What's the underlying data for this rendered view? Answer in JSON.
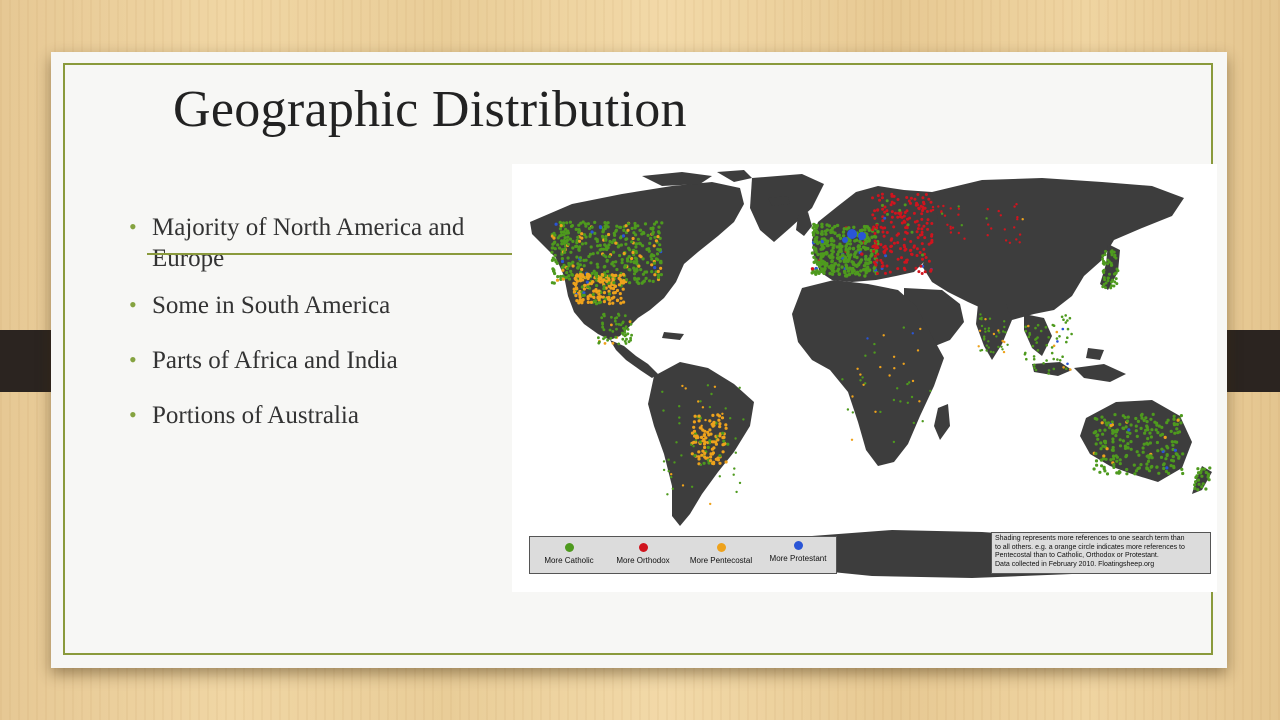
{
  "slide": {
    "title": "Geographic Distribution",
    "bullets": [
      "Majority of North America and Europe",
      "Some in South America",
      "Parts of Africa and India",
      "Portions of Australia"
    ]
  },
  "map": {
    "legend": [
      {
        "label": "More Catholic",
        "color": "#4e9a1e"
      },
      {
        "label": "More Orthodox",
        "color": "#d0141e"
      },
      {
        "label": "More Pentecostal",
        "color": "#eea21c"
      },
      {
        "label": "More Protestant",
        "color": "#2a55d6"
      }
    ],
    "note_lines": [
      "Shading represents more references to one search term than",
      "to all others. e.g. a orange circle indicates more references to",
      "Pentecostal than to Catholic, Orthodox or Protestant.",
      "Data collected in February 2010. Floatingsheep.org"
    ],
    "land_color": "#3d3d3d",
    "ocean_color": "#ffffff"
  }
}
